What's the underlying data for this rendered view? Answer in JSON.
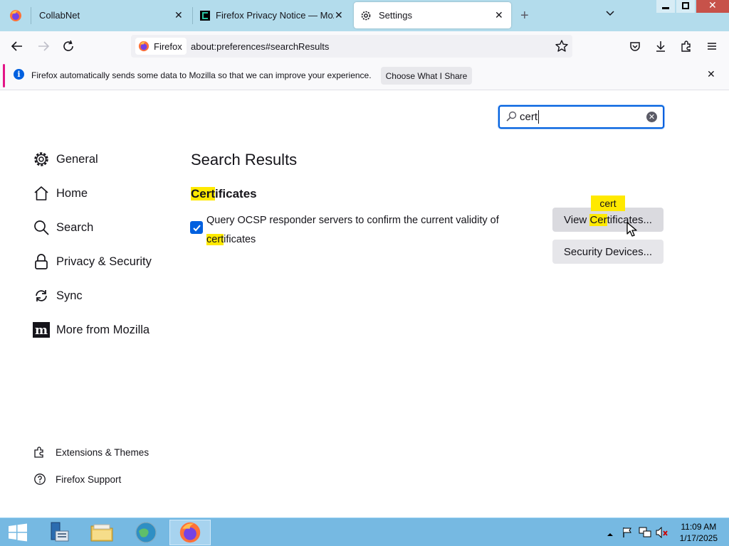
{
  "tabs": [
    {
      "label": "CollabNet",
      "icon": "firefox-icon"
    },
    {
      "label": "Firefox Privacy Notice — Mozilla",
      "icon": "mozilla-icon"
    },
    {
      "label": "Settings",
      "icon": "gear-icon",
      "active": true
    }
  ],
  "navbar": {
    "identity_label": "Firefox",
    "url": "about:preferences#searchResults"
  },
  "notification": {
    "text": "Firefox automatically sends some data to Mozilla so that we can improve your experience.",
    "button_label": "Choose What I Share"
  },
  "search": {
    "value": "cert"
  },
  "sidebar": {
    "categories": [
      {
        "label": "General",
        "icon": "gear-icon"
      },
      {
        "label": "Home",
        "icon": "home-icon"
      },
      {
        "label": "Search",
        "icon": "search-icon"
      },
      {
        "label": "Privacy & Security",
        "icon": "lock-icon"
      },
      {
        "label": "Sync",
        "icon": "sync-icon"
      },
      {
        "label": "More from Mozilla",
        "icon": "mozilla-m-icon"
      }
    ],
    "footer": [
      {
        "label": "Extensions & Themes",
        "icon": "puzzle-icon"
      },
      {
        "label": "Firefox Support",
        "icon": "help-icon"
      }
    ]
  },
  "main": {
    "title": "Search Results",
    "section_title_hl": "Cert",
    "section_title_rest": "ificates",
    "ocsp_label_line1": "Query OCSP responder servers to confirm the current validity of",
    "ocsp_label_hl": "cert",
    "ocsp_label_rest": "ificates",
    "ocsp_checked": true,
    "view_cert_pre": "View ",
    "view_cert_hl": "Cer",
    "view_cert_rest": "tificates...",
    "security_devices_label": "Security Devices...",
    "tooltip_term": "cert"
  },
  "taskbar": {
    "time": "11:09 AM",
    "date": "1/17/2025"
  },
  "colors": {
    "accent": "#0060df",
    "highlight": "#ffe900",
    "tabstrip": "#b3dcec",
    "taskbar": "#76b9e2"
  }
}
